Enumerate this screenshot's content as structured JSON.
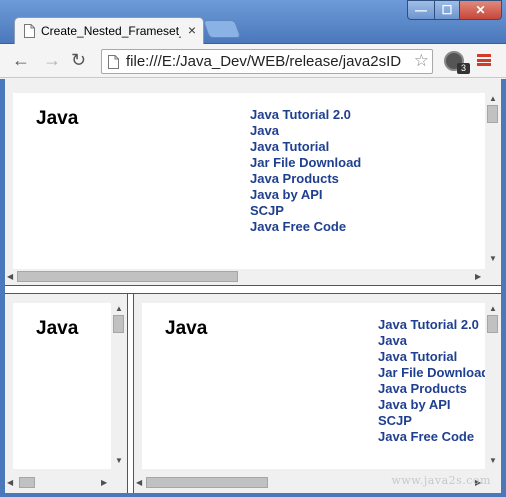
{
  "tab": {
    "title": "Create_Nested_Frameset_i",
    "close_glyph": "×"
  },
  "window_controls": {
    "minimize": "—",
    "maximize": "☐",
    "close": "✕"
  },
  "toolbar": {
    "back_glyph": "←",
    "forward_glyph": "→",
    "reload_glyph": "↻",
    "url": "file:///E:/Java_Dev/WEB/release/java2sID",
    "star_glyph": "☆",
    "extension_badge": "3"
  },
  "frames": {
    "top": {
      "heading": "Java",
      "links": [
        "Java Tutorial 2.0",
        "Java",
        "Java Tutorial",
        "Jar File Download",
        "Java Products",
        "Java by API",
        "SCJP",
        "Java Free Code"
      ]
    },
    "bottom_left": {
      "heading": "Java"
    },
    "bottom_right": {
      "heading": "Java",
      "links": [
        "Java Tutorial 2.0",
        "Java",
        "Java Tutorial",
        "Jar File Download",
        "Java Products",
        "Java by API",
        "SCJP",
        "Java Free Code"
      ]
    }
  },
  "watermark": "www.java2s.com",
  "colors": {
    "link": "#1f3f8f",
    "chrome": "#4a78bb",
    "menu_icon": "#d23b2a"
  },
  "icons": [
    "page-icon",
    "close-icon",
    "back-arrow-icon",
    "forward-arrow-icon",
    "reload-icon",
    "star-icon",
    "extension-icon",
    "menu-icon"
  ]
}
